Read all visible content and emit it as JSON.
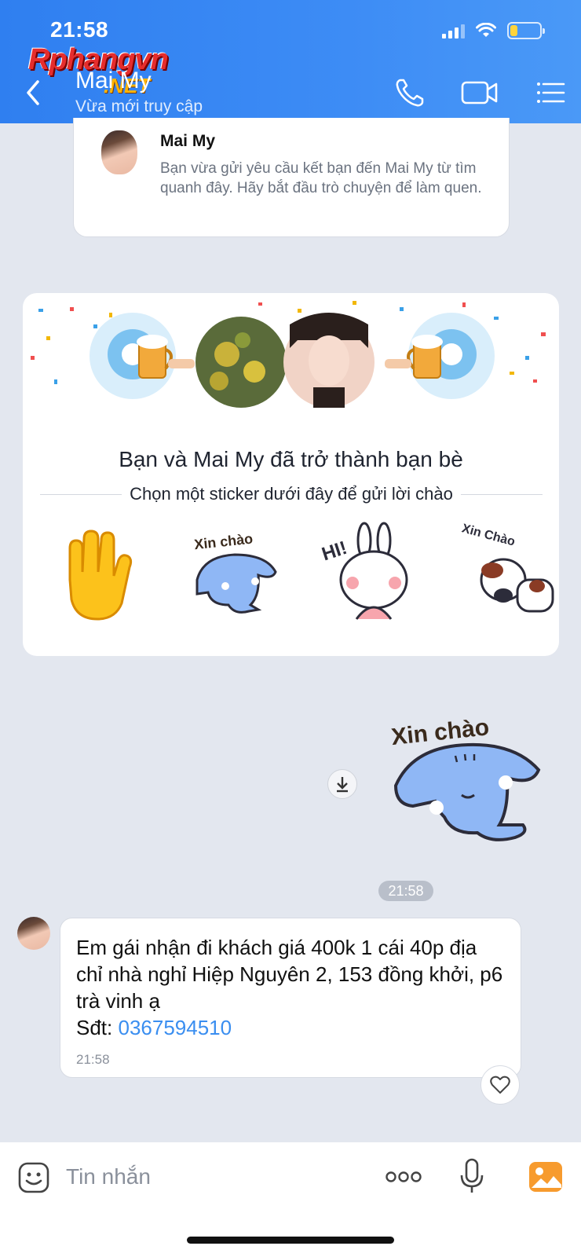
{
  "status_bar": {
    "time": "21:58"
  },
  "watermark": {
    "brand": "Rphangvn",
    "suffix": ".NET"
  },
  "header": {
    "contact_name": "Mai My",
    "contact_status": "Vừa mới truy cập",
    "icons": [
      "back-arrow-icon",
      "phone-icon",
      "video-call-icon",
      "menu-icon"
    ]
  },
  "friend_request": {
    "name": "Mai My",
    "text": "Bạn vừa gửi yêu cầu kết bạn đến Mai My từ tìm quanh đây. Hãy bắt đầu trò chuyện để làm quen."
  },
  "friend_card": {
    "title": "Bạn và Mai My đã trở thành bạn bè",
    "subtitle": "Chọn một sticker dưới đây để gửi lời chào",
    "stickers": [
      {
        "name": "waving-hand-sticker",
        "text": ""
      },
      {
        "name": "blue-cat-sticker",
        "text": "Xin chào"
      },
      {
        "name": "bunny-hi-sticker",
        "text": "HI!"
      },
      {
        "name": "dog-sticker",
        "text": "Xin Chào"
      }
    ]
  },
  "sent_sticker": {
    "text": "Xin chào"
  },
  "time_divider": "21:58",
  "incoming_message": {
    "line1": "Em gái nhận đi khách giá 400k 1 cái 40p địa chỉ nhà nghỉ Hiệp Nguyên 2, 153 đồng khởi, p6 trà vinh ạ",
    "phone_label": "Sđt: ",
    "phone": "0367594510",
    "time": "21:58"
  },
  "input_bar": {
    "placeholder": "Tin nhắn"
  },
  "colors": {
    "header": "#3d8cf5",
    "link": "#3a8ef0",
    "background": "#e3e7ef"
  }
}
